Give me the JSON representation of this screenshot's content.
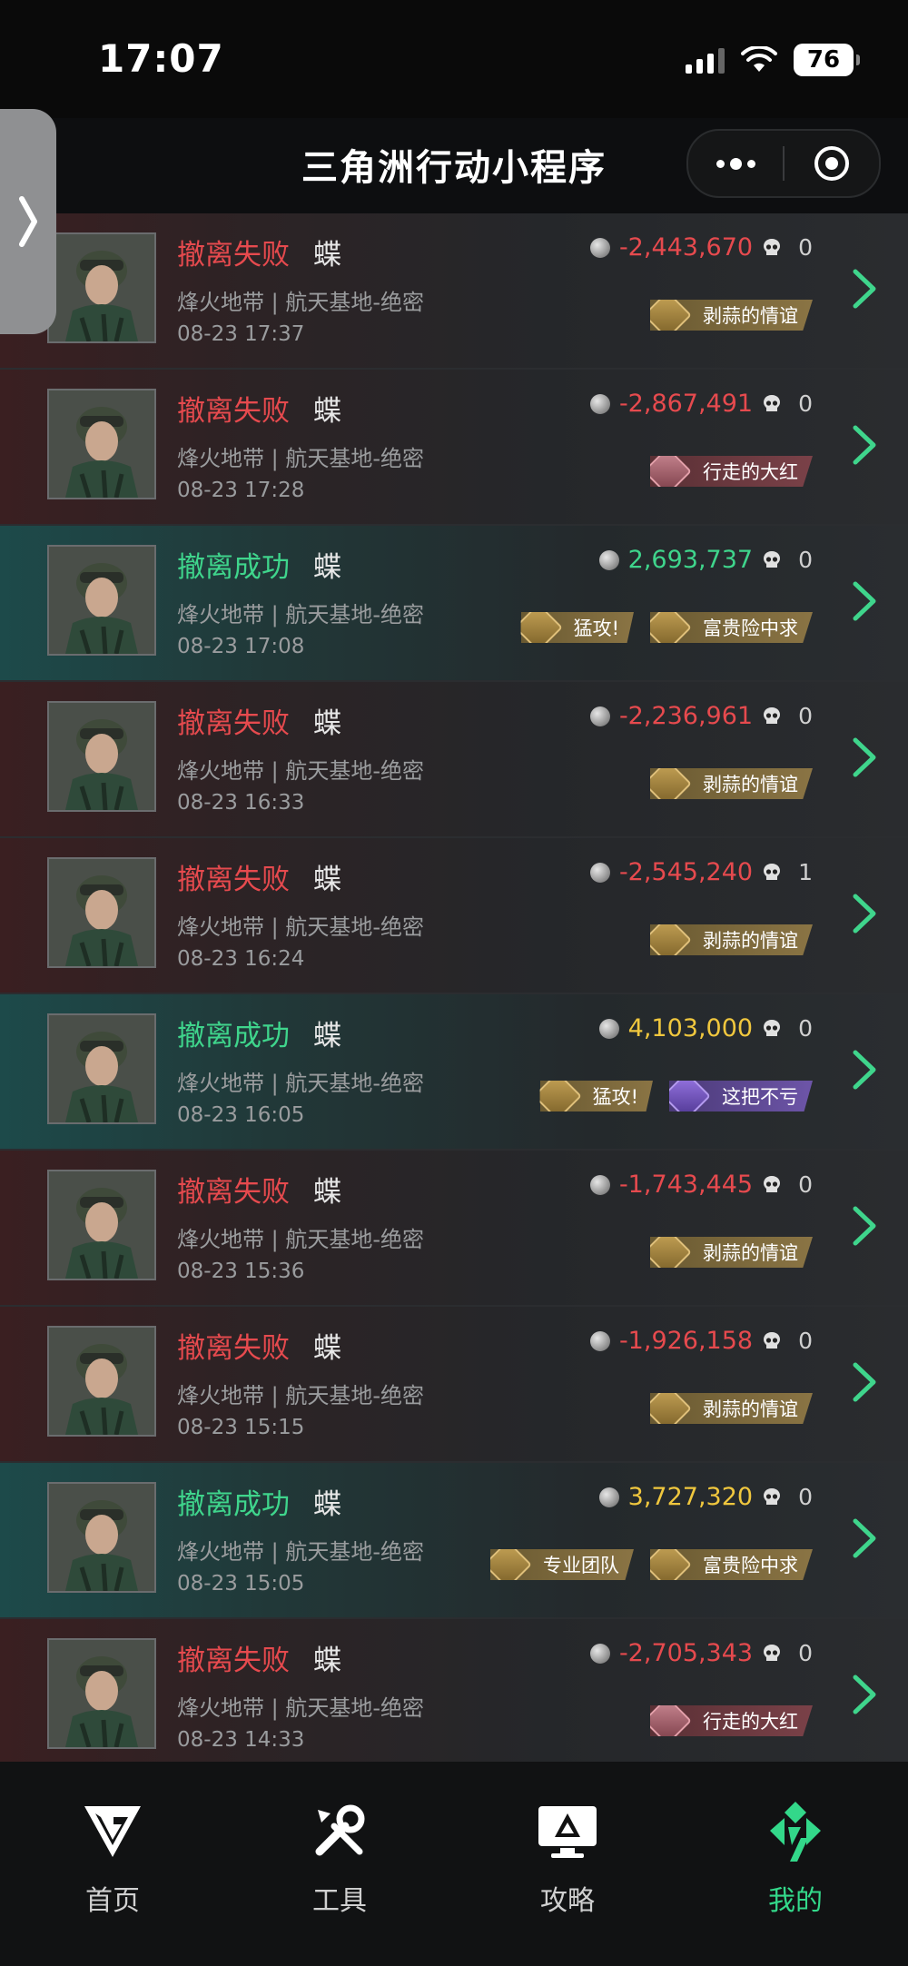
{
  "status_bar": {
    "time": "17:07",
    "battery": "76"
  },
  "header": {
    "title": "三角洲行动小程序"
  },
  "matches": [
    {
      "result": "撤离失败",
      "type": "fail",
      "operator": "蝶",
      "mode": "烽火地带 | 航天基地-绝密",
      "datetime": "08-23 17:37",
      "value": "-2,443,670",
      "value_style": "fail",
      "kills": "0",
      "badges": [
        {
          "label": "剥蒜的情谊",
          "style": "gold"
        }
      ]
    },
    {
      "result": "撤离失败",
      "type": "fail",
      "operator": "蝶",
      "mode": "烽火地带 | 航天基地-绝密",
      "datetime": "08-23 17:28",
      "value": "-2,867,491",
      "value_style": "fail",
      "kills": "0",
      "badges": [
        {
          "label": "行走的大红",
          "style": "red"
        }
      ]
    },
    {
      "result": "撤离成功",
      "type": "success",
      "operator": "蝶",
      "mode": "烽火地带 | 航天基地-绝密",
      "datetime": "08-23 17:08",
      "value": "2,693,737",
      "value_style": "success",
      "kills": "0",
      "badges": [
        {
          "label": "猛攻!",
          "style": "gold"
        },
        {
          "label": "富贵险中求",
          "style": "gold"
        }
      ]
    },
    {
      "result": "撤离失败",
      "type": "fail",
      "operator": "蝶",
      "mode": "烽火地带 | 航天基地-绝密",
      "datetime": "08-23 16:33",
      "value": "-2,236,961",
      "value_style": "fail",
      "kills": "0",
      "badges": [
        {
          "label": "剥蒜的情谊",
          "style": "gold"
        }
      ]
    },
    {
      "result": "撤离失败",
      "type": "fail",
      "operator": "蝶",
      "mode": "烽火地带 | 航天基地-绝密",
      "datetime": "08-23 16:24",
      "value": "-2,545,240",
      "value_style": "fail",
      "kills": "1",
      "badges": [
        {
          "label": "剥蒜的情谊",
          "style": "gold"
        }
      ]
    },
    {
      "result": "撤离成功",
      "type": "success",
      "operator": "蝶",
      "mode": "烽火地带 | 航天基地-绝密",
      "datetime": "08-23 16:05",
      "value": "4,103,000",
      "value_style": "gold",
      "kills": "0",
      "badges": [
        {
          "label": "猛攻!",
          "style": "gold"
        },
        {
          "label": "这把不亏",
          "style": "purple"
        }
      ]
    },
    {
      "result": "撤离失败",
      "type": "fail",
      "operator": "蝶",
      "mode": "烽火地带 | 航天基地-绝密",
      "datetime": "08-23 15:36",
      "value": "-1,743,445",
      "value_style": "fail",
      "kills": "0",
      "badges": [
        {
          "label": "剥蒜的情谊",
          "style": "gold"
        }
      ]
    },
    {
      "result": "撤离失败",
      "type": "fail",
      "operator": "蝶",
      "mode": "烽火地带 | 航天基地-绝密",
      "datetime": "08-23 15:15",
      "value": "-1,926,158",
      "value_style": "fail",
      "kills": "0",
      "badges": [
        {
          "label": "剥蒜的情谊",
          "style": "gold"
        }
      ]
    },
    {
      "result": "撤离成功",
      "type": "success",
      "operator": "蝶",
      "mode": "烽火地带 | 航天基地-绝密",
      "datetime": "08-23 15:05",
      "value": "3,727,320",
      "value_style": "gold",
      "kills": "0",
      "badges": [
        {
          "label": "专业团队",
          "style": "gold"
        },
        {
          "label": "富贵险中求",
          "style": "gold"
        }
      ]
    },
    {
      "result": "撤离失败",
      "type": "fail",
      "operator": "蝶",
      "mode": "烽火地带 | 航天基地-绝密",
      "datetime": "08-23 14:33",
      "value": "-2,705,343",
      "value_style": "fail",
      "kills": "0",
      "badges": [
        {
          "label": "行走的大红",
          "style": "red"
        }
      ]
    }
  ],
  "tabbar": {
    "tabs": [
      {
        "label": "首页",
        "icon": "home-logo-icon",
        "active": false
      },
      {
        "label": "工具",
        "icon": "tools-icon",
        "active": false
      },
      {
        "label": "攻略",
        "icon": "guide-monitor-icon",
        "active": false
      },
      {
        "label": "我的",
        "icon": "profile-logo-icon",
        "active": true
      }
    ]
  },
  "colors": {
    "fail": "#e64a4e",
    "success": "#3fd58c",
    "gold": "#f0c73e",
    "active_tab": "#33d88a"
  }
}
